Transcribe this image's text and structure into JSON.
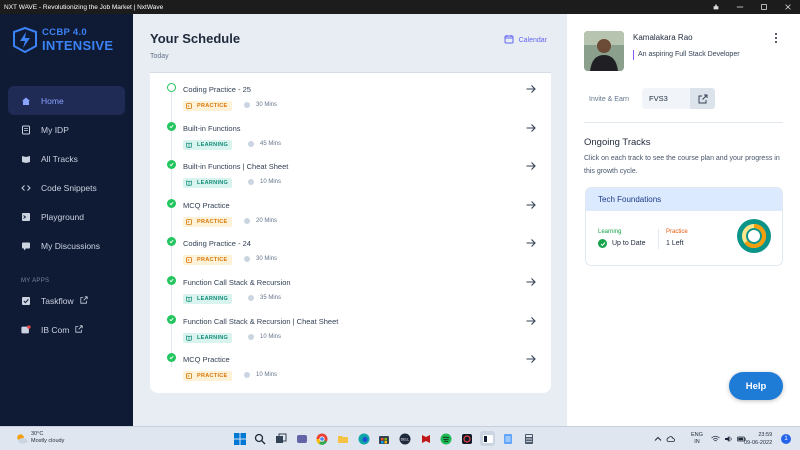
{
  "window": {
    "title": "NXT WAVE - Revolutionizing the Job Market | NxtWave"
  },
  "logo": {
    "line1": "CCBP 4.0",
    "line2": "INTENSIVE"
  },
  "sidebar": {
    "items": [
      {
        "label": "Home",
        "icon": "home-icon",
        "active": true
      },
      {
        "label": "My IDP",
        "icon": "idp-icon"
      },
      {
        "label": "All Tracks",
        "icon": "book-icon"
      },
      {
        "label": "Code Snippets",
        "icon": "code-icon"
      },
      {
        "label": "Playground",
        "icon": "terminal-icon"
      },
      {
        "label": "My Discussions",
        "icon": "discussion-icon"
      }
    ],
    "apps_label": "MY APPS",
    "apps": [
      {
        "label": "Taskflow",
        "icon": "taskflow-icon"
      },
      {
        "label": "IB Com",
        "icon": "ibcom-icon"
      }
    ]
  },
  "schedule": {
    "title": "Your Schedule",
    "subtitle": "Today",
    "calendar_label": "Calendar",
    "items": [
      {
        "title": "Coding Practice - 25",
        "type": "PRACTICE",
        "duration": "30 Mins",
        "done": false
      },
      {
        "title": "Built-in Functions",
        "type": "LEARNING",
        "duration": "45 Mins",
        "done": true
      },
      {
        "title": "Built-in Functions | Cheat Sheet",
        "type": "LEARNING",
        "duration": "10 Mins",
        "done": true
      },
      {
        "title": "MCQ Practice",
        "type": "PRACTICE",
        "duration": "20 Mins",
        "done": true
      },
      {
        "title": "Coding Practice - 24",
        "type": "PRACTICE",
        "duration": "30 Mins",
        "done": true
      },
      {
        "title": "Function Call Stack & Recursion",
        "type": "LEARNING",
        "duration": "35 Mins",
        "done": true
      },
      {
        "title": "Function Call Stack & Recursion | Cheat Sheet",
        "type": "LEARNING",
        "duration": "10 Mins",
        "done": true
      },
      {
        "title": "MCQ Practice",
        "type": "PRACTICE",
        "duration": "10 Mins",
        "done": true
      }
    ]
  },
  "profile": {
    "name": "Kamalakara Rao",
    "tagline": "An aspiring Full Stack Developer",
    "invite_label": "Invite & Earn",
    "invite_code": "FVS3"
  },
  "tracks": {
    "title": "Ongoing Tracks",
    "description": "Click on each track to see the course plan and your progress in this growth cycle.",
    "card": {
      "name": "Tech Foundations",
      "learning_label": "Learning",
      "learning_value": "Up to Date",
      "practice_label": "Practice",
      "practice_value": "1 Left"
    }
  },
  "help_label": "Help",
  "taskbar": {
    "temp": "30°C",
    "weather": "Mostly cloudy",
    "lang1": "ENG",
    "lang2": "IN",
    "time": "23:59",
    "date": "09-06-2022",
    "notifications": "1"
  },
  "colors": {
    "sidebar_bg": "#0f1b35",
    "accent": "#6366f1",
    "practice": "#d97706",
    "learning": "#0f8a76",
    "done": "#22c55e",
    "help": "#1e7bd6"
  }
}
